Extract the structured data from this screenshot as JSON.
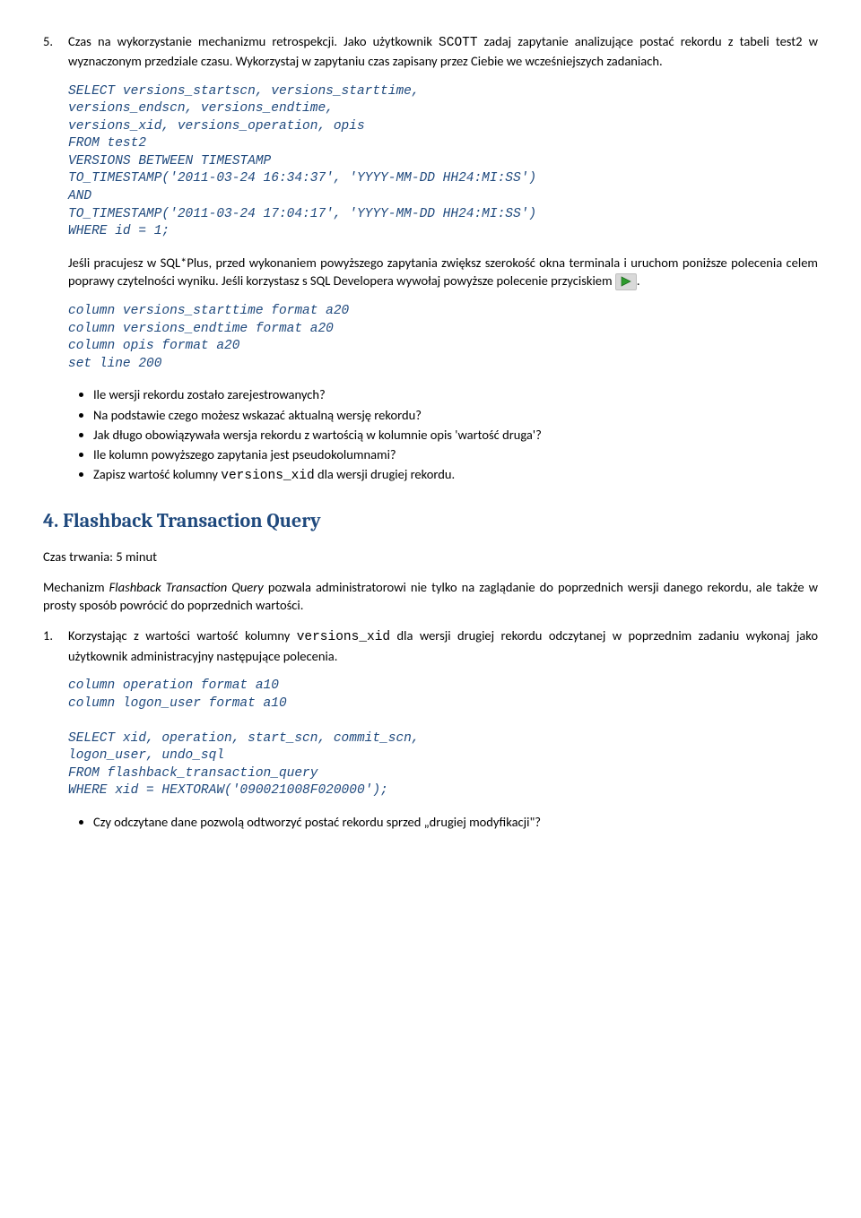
{
  "item5": {
    "num": "5.",
    "text_a": "Czas na wykorzystanie mechanizmu retrospekcji. Jako użytkownik ",
    "code_a": "SCOTT",
    "text_b": " zadaj zapytanie analizujące postać rekordu z tabeli test2 w wyznaczonym przedziale czasu. Wykorzystaj w zapytaniu czas zapisany przez Ciebie we wcześniejszych zadaniach."
  },
  "sql1": "SELECT versions_startscn, versions_starttime,\nversions_endscn, versions_endtime,\nversions_xid, versions_operation, opis\nFROM test2\nVERSIONS BETWEEN TIMESTAMP\nTO_TIMESTAMP('2011-03-24 16:34:37', 'YYYY-MM-DD HH24:MI:SS')\nAND\nTO_TIMESTAMP('2011-03-24 17:04:17', 'YYYY-MM-DD HH24:MI:SS')\nWHERE id = 1;",
  "para1_a": "Jeśli pracujesz w SQL*Plus, przed wykonaniem powyższego zapytania zwiększ szerokość okna terminala i uruchom poniższe polecenia celem poprawy czytelności wyniku. Jeśli korzystasz s SQL Developera wywołaj powyższe polecenie przyciskiem ",
  "para1_b": ".",
  "sql2": "column versions_starttime format a20\ncolumn versions_endtime format a20\ncolumn opis format a20\nset line 200",
  "bullets1": {
    "b1": "Ile wersji rekordu zostało zarejestrowanych?",
    "b2": "Na podstawie czego możesz wskazać aktualną wersję rekordu?",
    "b3": "Jak długo obowiązywała wersja rekordu z wartością w kolumnie opis 'wartość druga'?",
    "b4": "Ile kolumn powyższego zapytania jest pseudokolumnami?",
    "b5_a": "Zapisz wartość kolumny ",
    "b5_code": "versions_xid",
    "b5_b": " dla wersji drugiej rekordu."
  },
  "h2": "4. Flashback Transaction Query",
  "duration": "Czas trwania: 5 minut",
  "intro_a": "Mechanizm ",
  "intro_i": "Flashback Transaction Query",
  "intro_b": " pozwala administratorowi nie tylko na zaglądanie do poprzednich wersji danego rekordu, ale także w prosty sposób powrócić do poprzednich wartości.",
  "item1": {
    "num": "1.",
    "text_a": "Korzystając z wartości wartość kolumny ",
    "code_a": "versions_xid",
    "text_b": "  dla wersji drugiej rekordu odczytanej w poprzednim zadaniu wykonaj jako użytkownik administracyjny następujące polecenia."
  },
  "sql3": "column operation format a10\ncolumn logon_user format a10\n\nSELECT xid, operation, start_scn, commit_scn,\nlogon_user, undo_sql\nFROM flashback_transaction_query\nWHERE xid = HEXTORAW('090021008F020000');",
  "bullets2": {
    "b1": "Czy odczytane dane pozwolą odtworzyć postać rekordu sprzed „drugiej modyfikacji\"?"
  }
}
